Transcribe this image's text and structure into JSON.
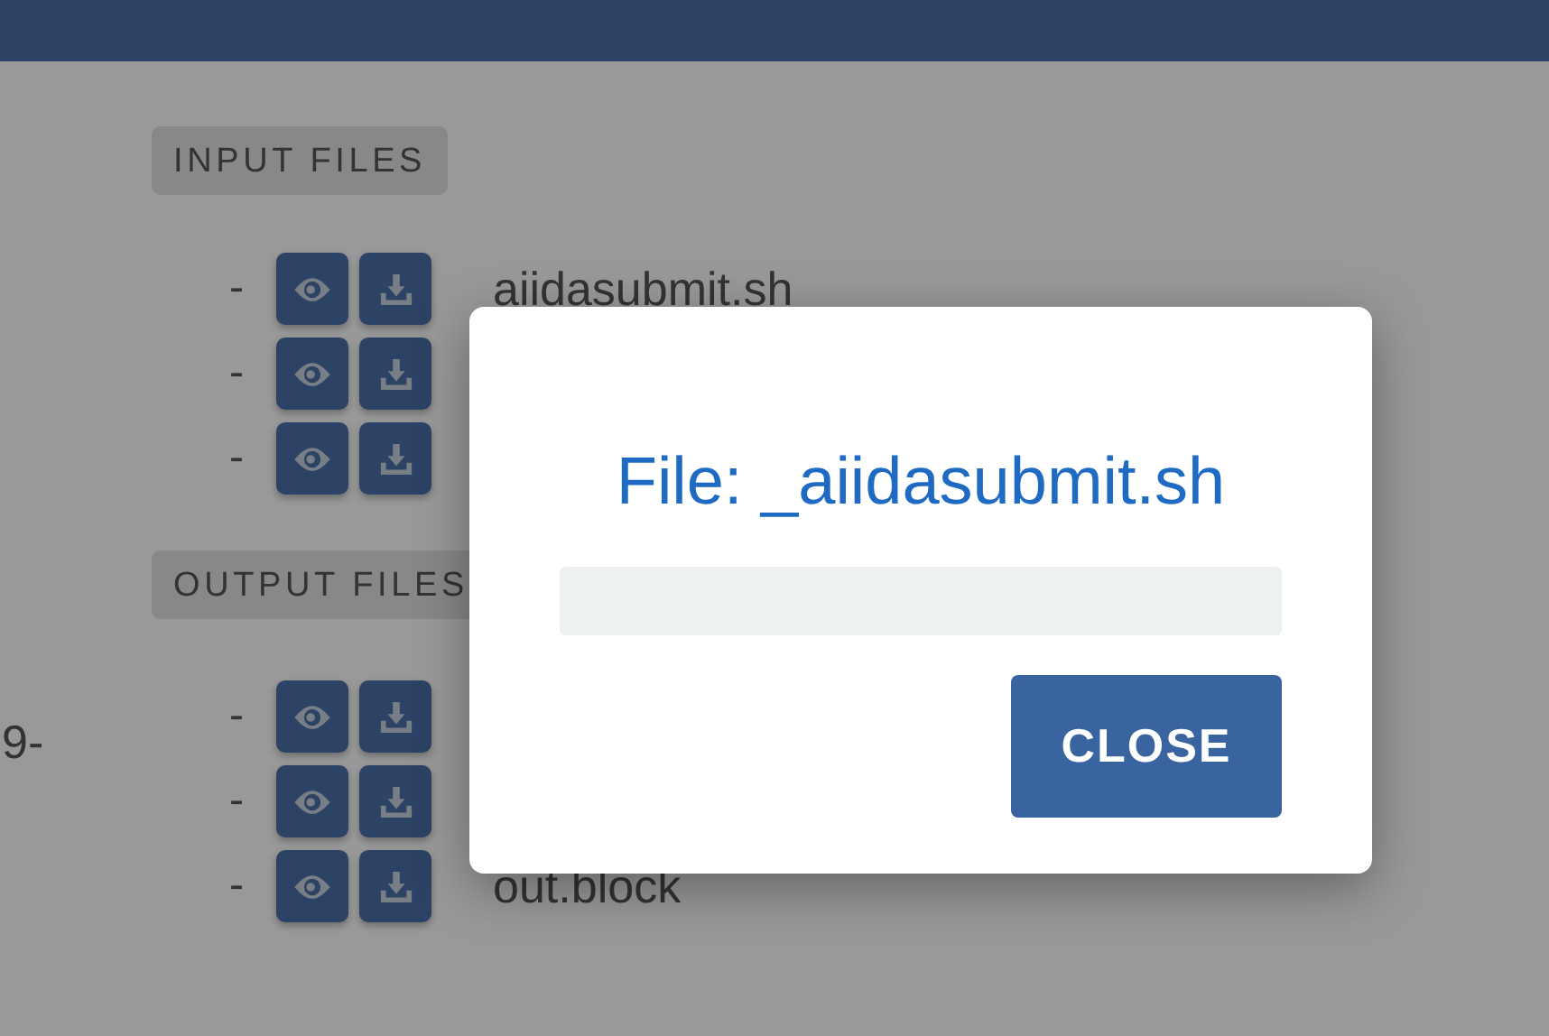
{
  "side_text": "9-",
  "sections": [
    {
      "label": "INPUT FILES",
      "rows": [
        {
          "dash": "-",
          "name": "aiidasubmit.sh"
        },
        {
          "dash": "-"
        },
        {
          "dash": "-"
        }
      ]
    },
    {
      "label": "OUTPUT FILES",
      "rows": [
        {
          "dash": "-"
        },
        {
          "dash": "-"
        },
        {
          "dash": "-",
          "name": "out.block"
        }
      ]
    }
  ],
  "modal": {
    "title": "File: _aiidasubmit.sh",
    "button": "CLOSE"
  }
}
